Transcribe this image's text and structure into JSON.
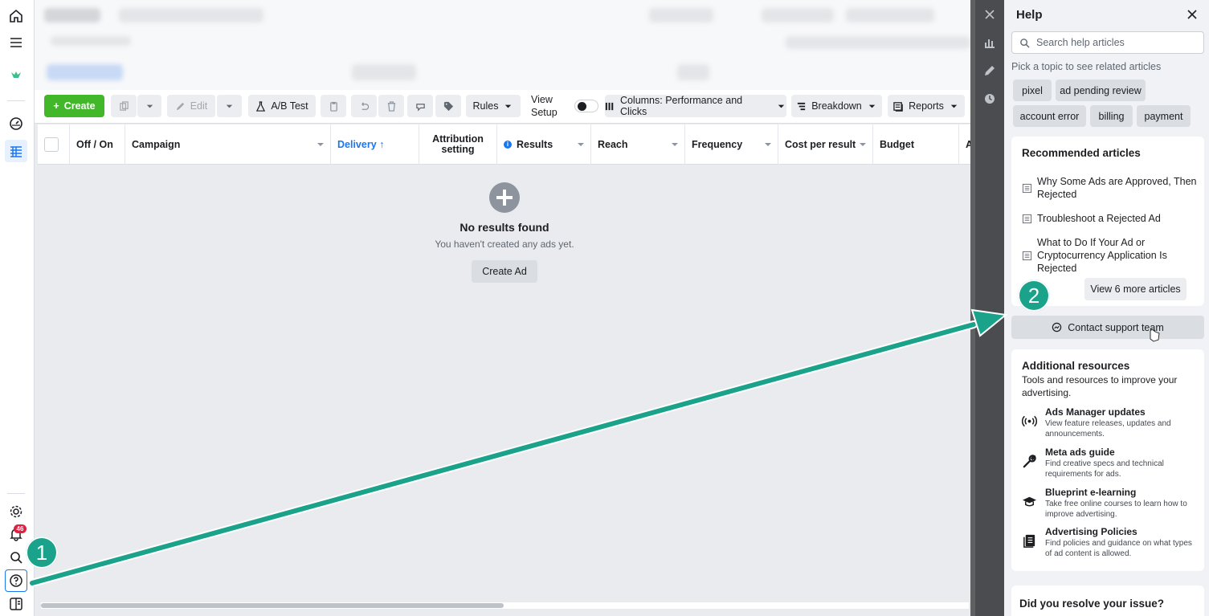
{
  "toolbar": {
    "create": "Create",
    "edit": "Edit",
    "ab_test": "A/B Test",
    "rules": "Rules",
    "view_setup": "View Setup",
    "columns": "Columns: Performance and Clicks",
    "breakdown": "Breakdown",
    "reports": "Reports"
  },
  "table": {
    "headers": {
      "off_on": "Off / On",
      "campaign": "Campaign",
      "delivery": "Delivery",
      "attribution": "Attribution setting",
      "results": "Results",
      "reach": "Reach",
      "frequency": "Frequency",
      "cost_per_result": "Cost per result",
      "budget": "Budget",
      "overflow": "A"
    },
    "sort_indicator": "↑"
  },
  "empty_state": {
    "title": "No results found",
    "subtitle": "You haven't created any ads yet.",
    "button": "Create Ad"
  },
  "sidebar": {
    "notification_count": "46",
    "icons": [
      "home-icon",
      "menu-icon",
      "meta-logo-icon",
      "dashboard-icon",
      "ads-manager-icon",
      "settings-icon",
      "bell-icon",
      "search-icon",
      "help-icon",
      "panel-icon"
    ]
  },
  "help": {
    "title": "Help",
    "search_placeholder": "Search help articles",
    "pick_topic": "Pick a topic to see related articles",
    "topics": [
      "pixel",
      "ad pending review",
      "account error",
      "billing",
      "payment"
    ],
    "recommended": {
      "title": "Recommended articles",
      "articles": [
        "Why Some Ads are Approved, Then Rejected",
        "Troubleshoot a Rejected Ad",
        "What to Do If Your Ad or Cryptocurrency Application Is Rejected"
      ],
      "view_more": "View 6 more articles"
    },
    "contact": "Contact support team",
    "additional": {
      "title": "Additional resources",
      "subtitle": "Tools and resources to improve your advertising.",
      "items": [
        {
          "title": "Ads Manager updates",
          "desc": "View feature releases, updates and announcements.",
          "icon": "broadcast-icon"
        },
        {
          "title": "Meta ads guide",
          "desc": "Find creative specs and technical requirements for ads.",
          "icon": "wrench-icon"
        },
        {
          "title": "Blueprint e-learning",
          "desc": "Take free online courses to learn how to improve advertising.",
          "icon": "graduation-cap-icon"
        },
        {
          "title": "Advertising Policies",
          "desc": "Find policies and guidance on what types of ad content is allowed.",
          "icon": "book-icon"
        }
      ]
    },
    "resolve": "Did you resolve your issue?"
  },
  "annotations": {
    "step1": "1",
    "step2": "2",
    "color": "#1aa38a"
  },
  "colors": {
    "accent": "#1877f2",
    "create_green": "#42b72a",
    "badge_red": "#e41e3f"
  }
}
